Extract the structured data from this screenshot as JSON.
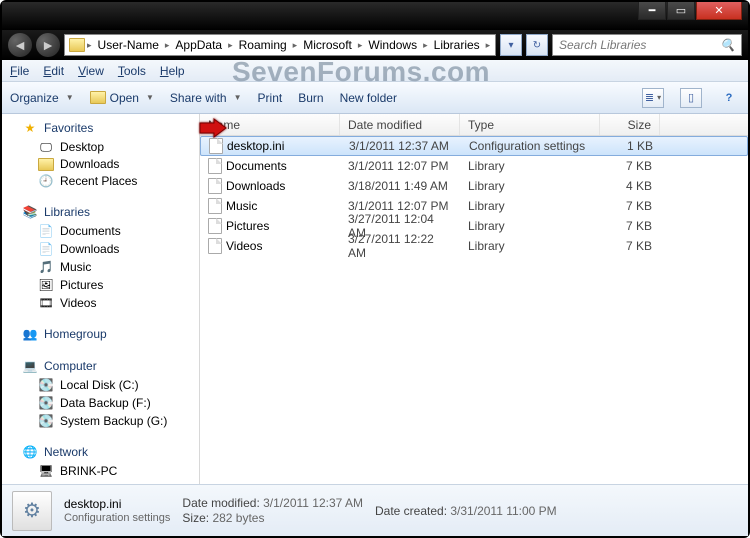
{
  "window": {
    "watermark": "SevenForums.com"
  },
  "breadcrumb": [
    "User-Name",
    "AppData",
    "Roaming",
    "Microsoft",
    "Windows",
    "Libraries"
  ],
  "search": {
    "placeholder": "Search Libraries"
  },
  "menu": {
    "file": "File",
    "edit": "Edit",
    "view": "View",
    "tools": "Tools",
    "help": "Help"
  },
  "toolbar": {
    "organize": "Organize",
    "open": "Open",
    "share": "Share with",
    "print": "Print",
    "burn": "Burn",
    "newfolder": "New folder"
  },
  "sidebar": {
    "favorites": {
      "label": "Favorites",
      "items": [
        "Desktop",
        "Downloads",
        "Recent Places"
      ]
    },
    "libraries": {
      "label": "Libraries",
      "items": [
        "Documents",
        "Downloads",
        "Music",
        "Pictures",
        "Videos"
      ]
    },
    "homegroup": {
      "label": "Homegroup"
    },
    "computer": {
      "label": "Computer",
      "items": [
        "Local Disk (C:)",
        "Data Backup (F:)",
        "System Backup (G:)"
      ]
    },
    "network": {
      "label": "Network",
      "items": [
        "BRINK-PC"
      ]
    }
  },
  "columns": {
    "name": "Name",
    "date": "Date modified",
    "type": "Type",
    "size": "Size"
  },
  "files": [
    {
      "name": "desktop.ini",
      "date": "3/1/2011 12:37 AM",
      "type": "Configuration settings",
      "size": "1 KB",
      "selected": true
    },
    {
      "name": "Documents",
      "date": "3/1/2011 12:07 PM",
      "type": "Library",
      "size": "7 KB",
      "selected": false
    },
    {
      "name": "Downloads",
      "date": "3/18/2011 1:49 AM",
      "type": "Library",
      "size": "4 KB",
      "selected": false
    },
    {
      "name": "Music",
      "date": "3/1/2011 12:07 PM",
      "type": "Library",
      "size": "7 KB",
      "selected": false
    },
    {
      "name": "Pictures",
      "date": "3/27/2011 12:04 AM",
      "type": "Library",
      "size": "7 KB",
      "selected": false
    },
    {
      "name": "Videos",
      "date": "3/27/2011 12:22 AM",
      "type": "Library",
      "size": "7 KB",
      "selected": false
    }
  ],
  "details": {
    "name": "desktop.ini",
    "type": "Configuration settings",
    "modified_label": "Date modified:",
    "modified": "3/1/2011 12:37 AM",
    "size_label": "Size:",
    "size": "282 bytes",
    "created_label": "Date created:",
    "created": "3/31/2011 11:00 PM"
  }
}
